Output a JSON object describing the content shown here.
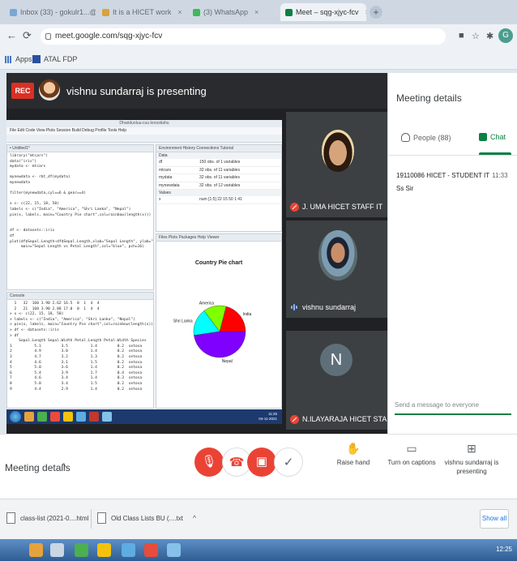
{
  "browser": {
    "tabs": [
      {
        "label": "Inbox (33) - gokulr1...@ HBBA...",
        "close": "×"
      },
      {
        "label": "It is a HICET work",
        "close": "×"
      },
      {
        "label": "(3) WhatsApp",
        "close": "×"
      },
      {
        "label": "Meet – sqg-xjyc-fcv",
        "close": "×"
      }
    ],
    "new_tab": "+",
    "url": "meet.google.com/sqg-xjyc-fcv",
    "profile_initial": "G",
    "bookmarks": [
      {
        "label": "Apps"
      },
      {
        "label": "ATAL FDP"
      }
    ]
  },
  "meet": {
    "rec_label": "REC",
    "presenting_text": "vishnu sundarraj is presenting",
    "participants": [
      {
        "name": "J. UMA HICET STAFF IT",
        "muted": true
      },
      {
        "name": "vishnu sundarraj",
        "muted": false
      },
      {
        "name": "N.ILAYARAJA HICET STAFF IT",
        "muted": true,
        "initial": "N"
      }
    ]
  },
  "rstudio": {
    "title": "Dhariduoluu-cuu kroostiahu",
    "menu": "File  Edit  Code  View  Plots  Session  Build  Debug  Profile  Tools  Help",
    "env_tabs": "Environment  History  Connections  Tutorial",
    "env_section_data": "Data",
    "env_section_values": "Values",
    "env_rows": [
      {
        "name": "df",
        "value": "150 obs. of 1 variables"
      },
      {
        "name": "mtcars",
        "value": "32 obs. of 11 variables"
      },
      {
        "name": "mydata",
        "value": "32 obs. of 11 variables"
      },
      {
        "name": "mynewdata",
        "value": "32 obs. of 12 variables"
      },
      {
        "name": "x",
        "value": "num [1:5] 22 15 50 1 41"
      }
    ],
    "plot_tabs": "Files  Plots  Packages  Help  Viewer",
    "console_label": "Console",
    "script_lines": [
      "library(\"mtcars\")",
      "data(\"iris\")",
      "mydata <- mtcars",
      "",
      "mynewdata <- rbt_df(mydata)",
      "mynewdata",
      "",
      "filter(mynewdata,cyl==6 & gear==4)",
      "",
      "x <- c(22, 15, 18, 50)",
      "labels <- c(\"India\", \"America\", \"Shri Lanka\", \"Nepal\")",
      "pie(x, labels, main=\"Country Pie chart\",col=rainbow(length(x)))",
      "",
      "",
      "df <- datasets::iris",
      "df",
      "plot(df$Sepal.Length~df$Sepal.Length,xlab=\"Sepal Length\", ylab=\"Petal Length\",",
      "     main=\"Sepal Length vs Petal Length\",col=\"blue\", pch=16)"
    ],
    "console_lines": [
      "  1   32  160 3.90 2.62 16.5  0  1  4  4",
      "  2   21  160 3.90 2.88 17.0  0  1  4  4",
      "> x <- c(22, 15, 18, 50)",
      "> labels <- c(\"India\", \"America\", \"Shri Lanka\", \"Nepal\")",
      "> pie(x, labels, main=\"Country Pie chart\",col=rainbow(length(x)))",
      "> df <- datasets::iris",
      "> df",
      "    Sepal.Length Sepal.Width Petal.Length Petal.Width Species",
      "1          5.1         3.5          1.4         0.2  setosa",
      "2          4.9         3.0          1.4         0.2  setosa",
      "3          4.7         3.2          1.3         0.2  setosa",
      "4          4.6         3.1          1.5         0.2  setosa",
      "5          5.0         3.6          1.4         0.2  setosa",
      "6          5.4         3.9          1.7         0.4  setosa",
      "7          4.6         3.4          1.4         0.3  setosa",
      "8          5.0         3.4          1.5         0.2  setosa",
      "9          4.4         2.9          1.4         0.2  setosa"
    ],
    "taskbar_time": "11:25",
    "taskbar_date": "04-11-2021"
  },
  "chart_data": {
    "type": "pie",
    "title": "Country Pie chart",
    "categories": [
      "India",
      "America",
      "Shri Lanka",
      "Nepal"
    ],
    "values": [
      22,
      15,
      18,
      50
    ],
    "colors": [
      "#ff0000",
      "#80ff00",
      "#00ffff",
      "#8000ff"
    ]
  },
  "panel": {
    "title": "Meeting details",
    "people_tab": "People (88)",
    "chat_tab": "Chat",
    "message_sender": "19110086 HICET - STUDENT IT",
    "message_time": "11:33",
    "message_text": "Ss Sir",
    "input_placeholder": "Send a message to everyone"
  },
  "controls": {
    "meeting_details": "Meeting details",
    "raise_hand": "Raise hand",
    "captions": "Turn on captions",
    "presenting": "vishnu sundarraj is presenting"
  },
  "downloads": {
    "items": [
      {
        "label": "class-list (2021-0....html"
      },
      {
        "label": "Old Class Lists BU (....txt"
      }
    ],
    "show_all": "Show all"
  },
  "windows": {
    "time": "12:25"
  }
}
